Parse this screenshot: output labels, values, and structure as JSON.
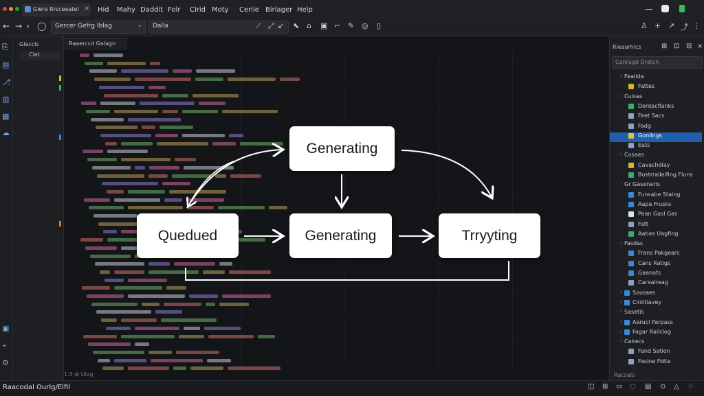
{
  "titlebar": {
    "tab_title": "Glera Rrsceeatel",
    "tab_close": "×",
    "menu": [
      "Hid",
      "Mahy",
      "Daddit",
      "Folr",
      "Cirid",
      "Moty",
      "Cerile",
      "Birlager",
      "Help"
    ],
    "right_icons": [
      "minimize-icon",
      "app-badge-icon",
      "battery-icon"
    ]
  },
  "toolbar": {
    "branch_select": "Gercer Gefrg Iblag",
    "run_select": "Dalla"
  },
  "explorer": {
    "title": "Glaccls",
    "item": "Ciat"
  },
  "editor": {
    "tab_label": "Raaerccd Galagn",
    "footer": "1:5 ⊞  Ulag"
  },
  "diagram": {
    "node_top": "Generating",
    "node_queued": "Quedued",
    "node_middle": "Generating",
    "node_trying": "Trryyting"
  },
  "panel": {
    "title": "Rieaarhics",
    "search_placeholder": "Canragd Dratch",
    "items": [
      {
        "label": "Fealida",
        "indent": 1,
        "chevron": true,
        "icon": ""
      },
      {
        "label": "Fattes",
        "indent": 2,
        "chevron": false,
        "icon": "#d9b232"
      },
      {
        "label": "Cuisas",
        "indent": 1,
        "chevron": true,
        "icon": ""
      },
      {
        "label": "Derdacfianks",
        "indent": 2,
        "chevron": false,
        "icon": "#3faa6a"
      },
      {
        "label": "Feet Sacs",
        "indent": 2,
        "chevron": false,
        "icon": "#8ea0c4"
      },
      {
        "label": "Fadg",
        "indent": 2,
        "chevron": false,
        "icon": "#8ea0c4"
      },
      {
        "label": "Gonlings",
        "indent": 2,
        "chevron": false,
        "icon": "#e3c14a"
      },
      {
        "label": "Eats",
        "indent": 2,
        "chevron": false,
        "icon": "#8ea0c4"
      },
      {
        "label": "Cosaes",
        "indent": 1,
        "chevron": true,
        "icon": ""
      },
      {
        "label": "Cavachdlay",
        "indent": 2,
        "chevron": false,
        "icon": "#d9b232"
      },
      {
        "label": "Bustrralleifing Fluns",
        "indent": 2,
        "chevron": false,
        "icon": "#3faa6a"
      },
      {
        "label": "Gr Gasenaris",
        "indent": 1,
        "chevron": true,
        "icon": ""
      },
      {
        "label": "Funsabe Staing",
        "indent": 2,
        "chevron": false,
        "icon": "#3a88d8"
      },
      {
        "label": "Aapa Frusks",
        "indent": 2,
        "chevron": false,
        "icon": "#3a88d8"
      },
      {
        "label": "Pean Gasl Gas",
        "indent": 2,
        "chevron": false,
        "icon": "#dfe2e8"
      },
      {
        "label": "Fatt",
        "indent": 2,
        "chevron": false,
        "icon": "#8ea0c4"
      },
      {
        "label": "Aaties Uagfing",
        "indent": 2,
        "chevron": false,
        "icon": "#3faa6a"
      },
      {
        "label": "Fasdas",
        "indent": 1,
        "chevron": true,
        "icon": ""
      },
      {
        "label": "Frans Pakgears",
        "indent": 2,
        "chevron": false,
        "icon": "#3a88d8"
      },
      {
        "label": "Cans Ratigs",
        "indent": 2,
        "chevron": false,
        "icon": "#3a88d8"
      },
      {
        "label": "Gaanats",
        "indent": 2,
        "chevron": false,
        "icon": "#3a88d8"
      },
      {
        "label": "Caraalreag",
        "indent": 2,
        "chevron": false,
        "icon": "#8ea0c4"
      },
      {
        "label": "Sousaes",
        "indent": 1,
        "chevron": true,
        "icon": "#3a88d8"
      },
      {
        "label": "Cinlitiavey",
        "indent": 1,
        "chevron": true,
        "icon": "#3a88d8"
      },
      {
        "label": "Sasetis",
        "indent": 1,
        "chevron": true,
        "icon": ""
      },
      {
        "label": "Aarucl Parpass",
        "indent": 1,
        "chevron": true,
        "icon": "#3a88d8"
      },
      {
        "label": "Fagar Railclog",
        "indent": 1,
        "chevron": true,
        "icon": "#3a88d8"
      },
      {
        "label": "Calrecs",
        "indent": 1,
        "chevron": true,
        "icon": ""
      },
      {
        "label": "Fand Sation",
        "indent": 2,
        "chevron": false,
        "icon": "#8ea0c4"
      },
      {
        "label": "Fasine Fidta",
        "indent": 2,
        "chevron": false,
        "icon": "#8ea0c4"
      }
    ],
    "footer": "Racsals"
  },
  "status": {
    "text": "Raacodal Ourlg/Elfil"
  }
}
